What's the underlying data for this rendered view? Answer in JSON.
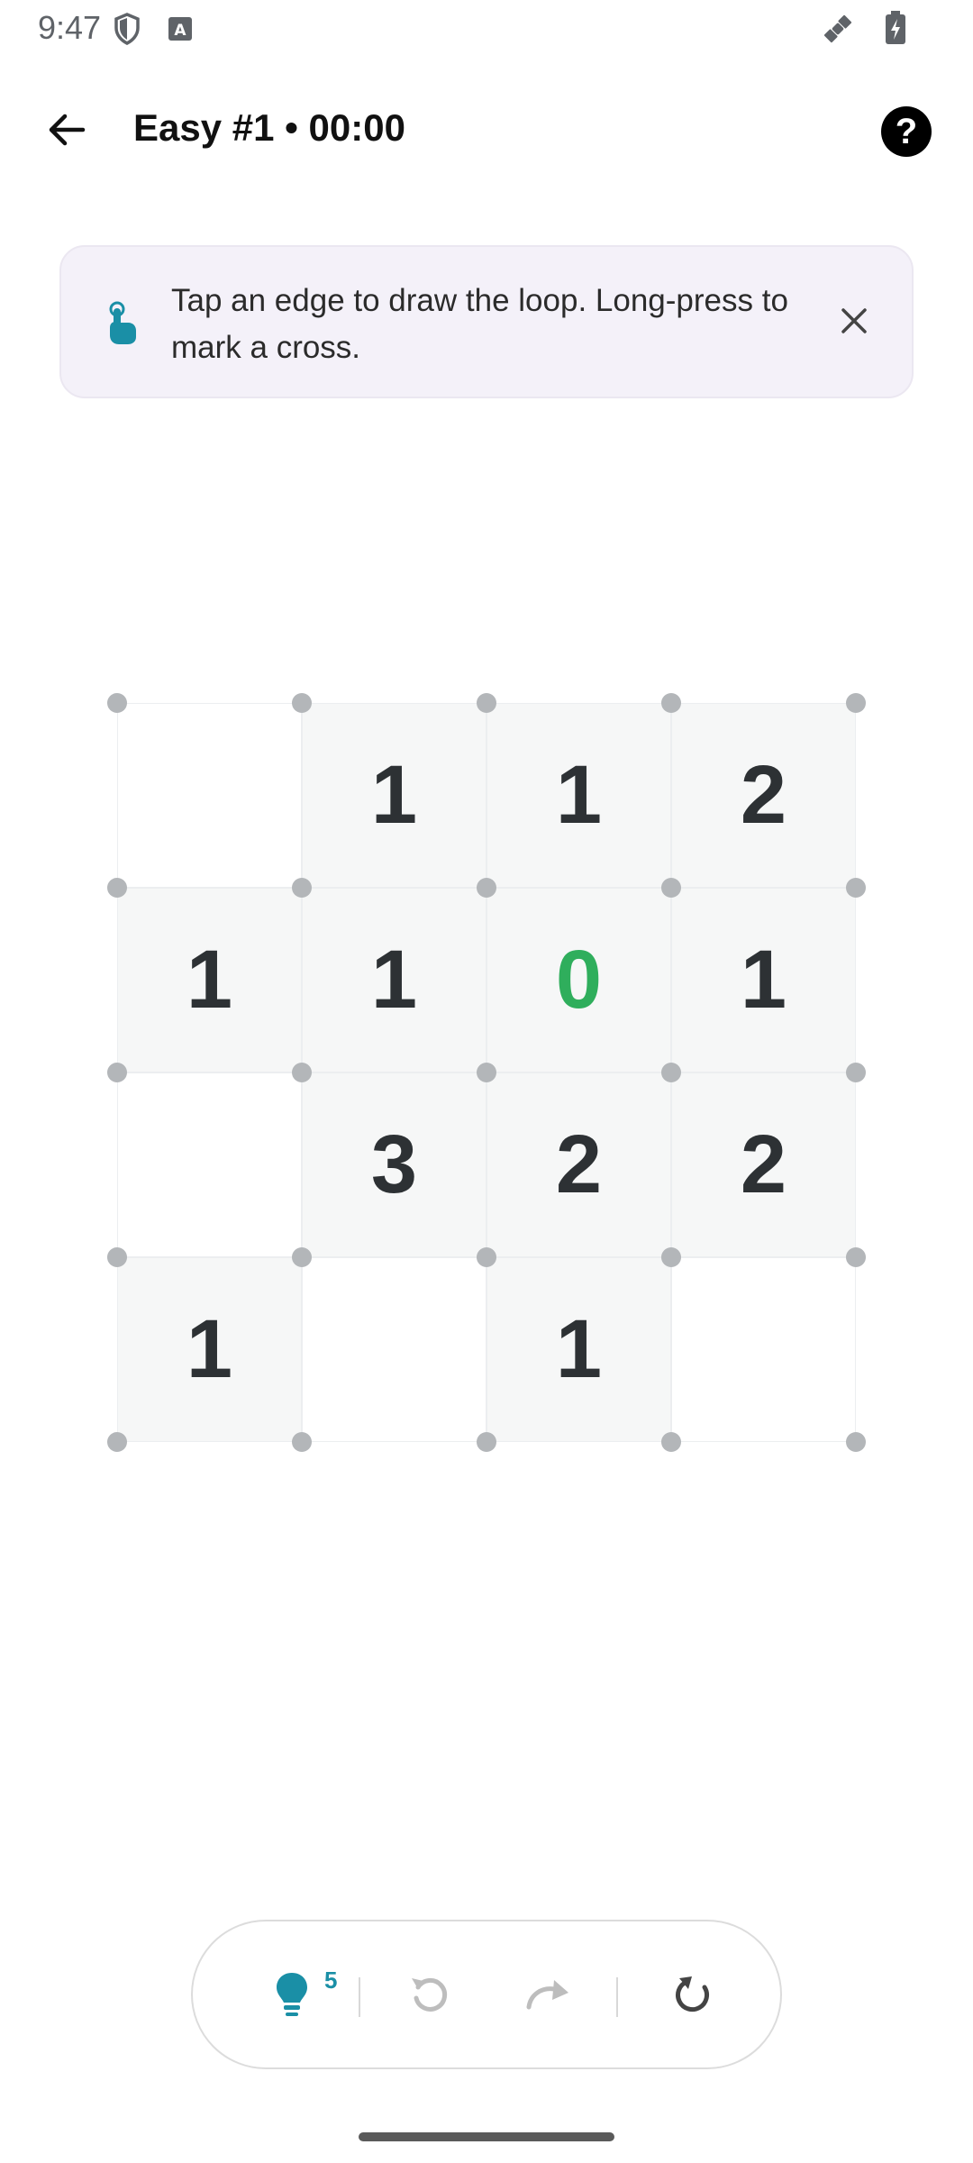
{
  "status_bar": {
    "time": "9:47",
    "icons": [
      "shield-icon",
      "keyboard-a-icon",
      "satellite-icon",
      "battery-charging-icon"
    ]
  },
  "app_bar": {
    "title": "Easy #1 • 00:00",
    "back_icon": "arrow-left-icon",
    "help_label": "?"
  },
  "hint_banner": {
    "icon": "tap-hand-icon",
    "text": "Tap an edge to draw the loop. Long-press to mark a cross.",
    "close_icon": "close-icon"
  },
  "puzzle": {
    "rows": 4,
    "cols": 4,
    "cells": [
      [
        "",
        "1",
        "1",
        "2"
      ],
      [
        "1",
        "1",
        "0",
        "1"
      ],
      [
        "",
        "3",
        "2",
        "2"
      ],
      [
        "1",
        "",
        "1",
        ""
      ]
    ],
    "satisfied": [
      [
        1,
        2
      ]
    ]
  },
  "toolbar": {
    "hint_count": "5",
    "tools": [
      "lightbulb-icon",
      "undo-icon",
      "redo-icon",
      "restart-icon"
    ]
  },
  "colors": {
    "accent": "#1a8fa6",
    "satisfied": "#2fae5c",
    "clue_text": "#2d3134",
    "banner_bg": "#f4f1f9",
    "dot": "#b3b6b9"
  }
}
